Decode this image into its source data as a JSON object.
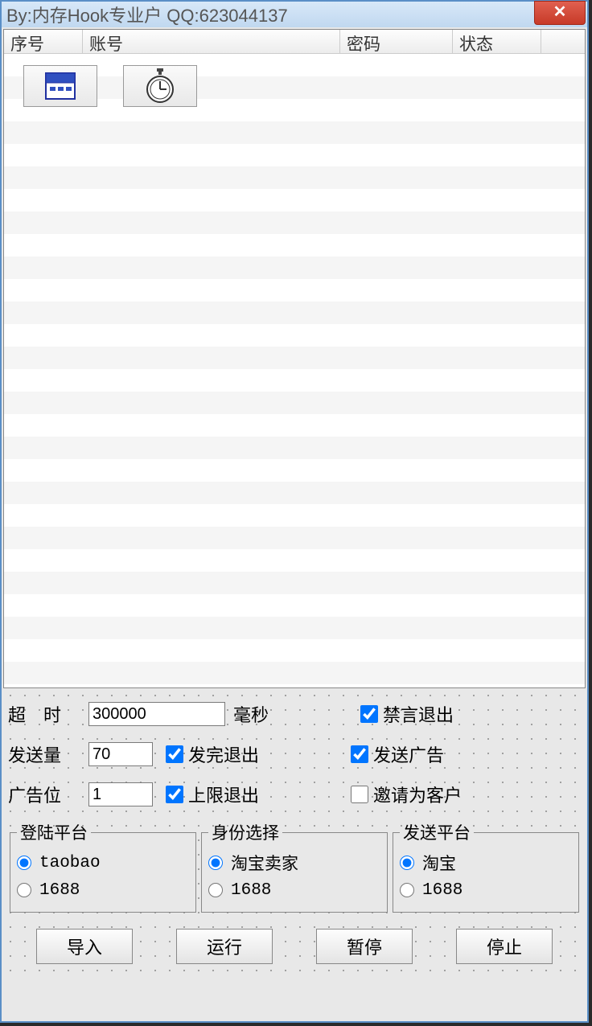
{
  "window": {
    "title": "By:内存Hook专业户  QQ:623044137"
  },
  "listview": {
    "columns": [
      "序号",
      "账号",
      "密码",
      "状态"
    ]
  },
  "settings": {
    "timeout_label_left": "超　时",
    "timeout_value": "300000",
    "timeout_unit": "毫秒",
    "send_count_label": "发送量",
    "send_count_value": "70",
    "ad_pos_label": "广告位",
    "ad_pos_value": "1",
    "chk_ban_exit": "禁言退出",
    "chk_send_ad": "发送广告",
    "chk_invite": "邀请为客户",
    "chk_finish_exit": "发完退出",
    "chk_limit_exit": "上限退出"
  },
  "groups": {
    "login_platform": {
      "legend": "登陆平台",
      "opt1": "taobao",
      "opt2": "1688"
    },
    "identity": {
      "legend": "身份选择",
      "opt1": "淘宝卖家",
      "opt2": "1688"
    },
    "send_platform": {
      "legend": "发送平台",
      "opt1": "淘宝",
      "opt2": "1688"
    }
  },
  "buttons": {
    "import": "导入",
    "run": "运行",
    "pause": "暂停",
    "stop": "停止"
  }
}
